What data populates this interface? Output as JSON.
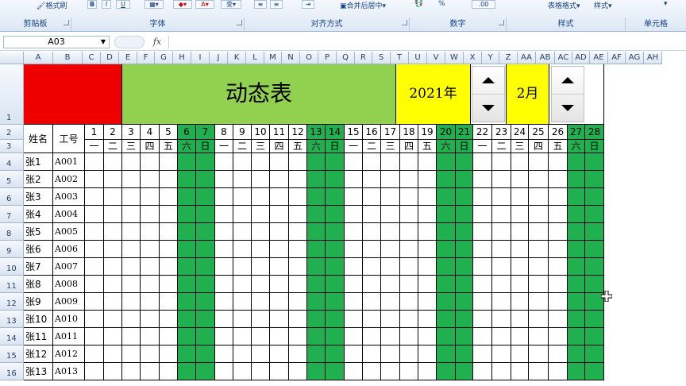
{
  "ribbon": {
    "top_items": [
      "格式刷",
      "B",
      "I",
      "U",
      "合并后居中",
      "%",
      "表格格式",
      "样式"
    ],
    "groups": [
      "剪贴板",
      "字体",
      "对齐方式",
      "数字",
      "样式",
      "单元格"
    ]
  },
  "formula_bar": {
    "name_box": "A03",
    "fx": "fx",
    "formula": ""
  },
  "columns": [
    "A",
    "B",
    "C",
    "D",
    "E",
    "F",
    "G",
    "H",
    "I",
    "J",
    "K",
    "L",
    "M",
    "N",
    "O",
    "P",
    "Q",
    "R",
    "S",
    "T",
    "U",
    "V",
    "W",
    "X",
    "Y",
    "Z",
    "AA",
    "AB",
    "AC",
    "AD",
    "AE",
    "AF",
    "AG",
    "AH"
  ],
  "row_numbers": [
    "1",
    "2",
    "3",
    "4",
    "5",
    "6",
    "7",
    "8",
    "9",
    "10",
    "11",
    "12",
    "13",
    "14",
    "15",
    "16"
  ],
  "sheet": {
    "title": "动态表",
    "year": "2021年",
    "month": "2月",
    "name_header": "姓名",
    "id_header": "工号",
    "days": [
      "1",
      "2",
      "3",
      "4",
      "5",
      "6",
      "7",
      "8",
      "9",
      "10",
      "11",
      "12",
      "13",
      "14",
      "15",
      "16",
      "17",
      "18",
      "19",
      "20",
      "21",
      "22",
      "23",
      "24",
      "25",
      "26",
      "27",
      "28"
    ],
    "weekdays": [
      "一",
      "二",
      "三",
      "四",
      "五",
      "六",
      "日",
      "一",
      "二",
      "三",
      "四",
      "五",
      "六",
      "日",
      "一",
      "二",
      "三",
      "四",
      "五",
      "六",
      "日",
      "一",
      "二",
      "三",
      "四",
      "五",
      "六",
      "日"
    ],
    "weekend_indices": [
      5,
      6,
      12,
      13,
      19,
      20,
      26,
      27
    ],
    "employees": [
      {
        "name": "张1",
        "id": "A001"
      },
      {
        "name": "张2",
        "id": "A002"
      },
      {
        "name": "张3",
        "id": "A003"
      },
      {
        "name": "张4",
        "id": "A004"
      },
      {
        "name": "张5",
        "id": "A005"
      },
      {
        "name": "张6",
        "id": "A006"
      },
      {
        "name": "张7",
        "id": "A007"
      },
      {
        "name": "张8",
        "id": "A008"
      },
      {
        "name": "张9",
        "id": "A009"
      },
      {
        "name": "张10",
        "id": "A010"
      },
      {
        "name": "张11",
        "id": "A011"
      },
      {
        "name": "张12",
        "id": "A012"
      },
      {
        "name": "张13",
        "id": "A013"
      }
    ]
  },
  "colors": {
    "red": "#ee0000",
    "title_green": "#92d050",
    "yellow": "#ffff00",
    "weekend_green": "#20b050"
  }
}
